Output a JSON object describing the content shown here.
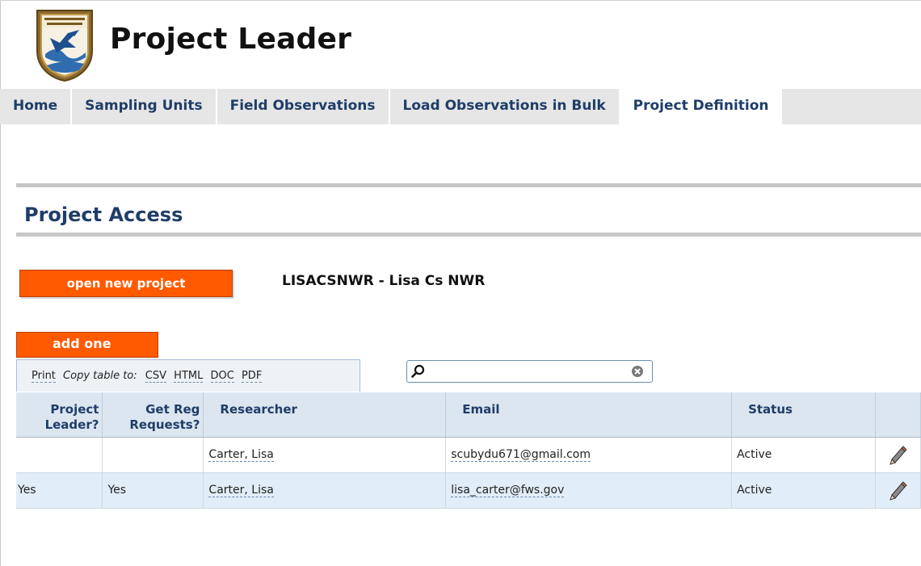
{
  "header": {
    "title": "Project Leader"
  },
  "nav": {
    "tabs": [
      {
        "label": "Home",
        "active": false
      },
      {
        "label": "Sampling Units",
        "active": false
      },
      {
        "label": "Field Observations",
        "active": false
      },
      {
        "label": "Load Observations in Bulk",
        "active": false
      },
      {
        "label": "Project Definition",
        "active": true
      }
    ]
  },
  "section": {
    "title": "Project Access"
  },
  "actions": {
    "open_new_project": "open new project",
    "add_one": "add one"
  },
  "project": {
    "name": "LISACSNWR - Lisa Cs NWR"
  },
  "toolbar": {
    "print": "Print",
    "copy_label": "Copy table to:",
    "formats": [
      "CSV",
      "HTML",
      "DOC",
      "PDF"
    ],
    "search_value": ""
  },
  "table": {
    "headers": {
      "leader_line1": "Project",
      "leader_line2": "Leader?",
      "reg_line1": "Get Reg",
      "reg_line2": "Requests?",
      "researcher": "Researcher",
      "email": "Email",
      "status": "Status"
    },
    "rows": [
      {
        "leader": "",
        "reg": "",
        "researcher": "Carter, Lisa",
        "email": "scubydu671@gmail.com",
        "status": "Active"
      },
      {
        "leader": "Yes",
        "reg": "Yes",
        "researcher": "Carter, Lisa",
        "email": "lisa_carter@fws.gov",
        "status": "Active"
      }
    ]
  },
  "icons": {
    "logo": "fish-and-wildlife-service-shield-icon",
    "search": "search-icon",
    "clear": "clear-icon",
    "edit": "pencil-icon"
  },
  "colors": {
    "accent": "#ff5a00",
    "nav_text": "#1f3d68",
    "header_bg": "#dce6f0",
    "row_alt": "#e1edf8"
  }
}
